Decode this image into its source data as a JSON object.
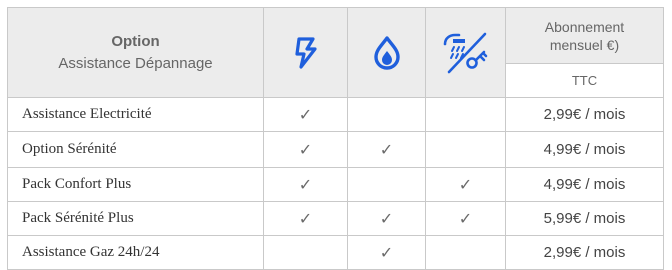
{
  "header": {
    "option_label": "Option",
    "option_sub": "Assistance Dépannage",
    "subscription_label": "Abonnement mensuel €)",
    "ttc_label": "TTC",
    "icons": [
      "lightning-icon",
      "gas-flame-icon",
      "shower-faucet-icon"
    ]
  },
  "accent_color": "#1f5fdc",
  "rows": [
    {
      "name": "Assistance Electricité",
      "elec": "✓",
      "gas": "",
      "water": "",
      "price": "2,99€ / mois"
    },
    {
      "name": "Option Sérénité",
      "elec": "✓",
      "gas": "✓",
      "water": "",
      "price": "4,99€ / mois"
    },
    {
      "name": "Pack Confort Plus",
      "elec": "✓",
      "gas": "",
      "water": "✓",
      "price": "4,99€ / mois"
    },
    {
      "name": "Pack Sérénité Plus",
      "elec": "✓",
      "gas": "✓",
      "water": "✓",
      "price": "5,99€ / mois"
    },
    {
      "name": "Assistance Gaz 24h/24",
      "elec": "",
      "gas": "✓",
      "water": "",
      "price": "2,99€ / mois"
    }
  ]
}
